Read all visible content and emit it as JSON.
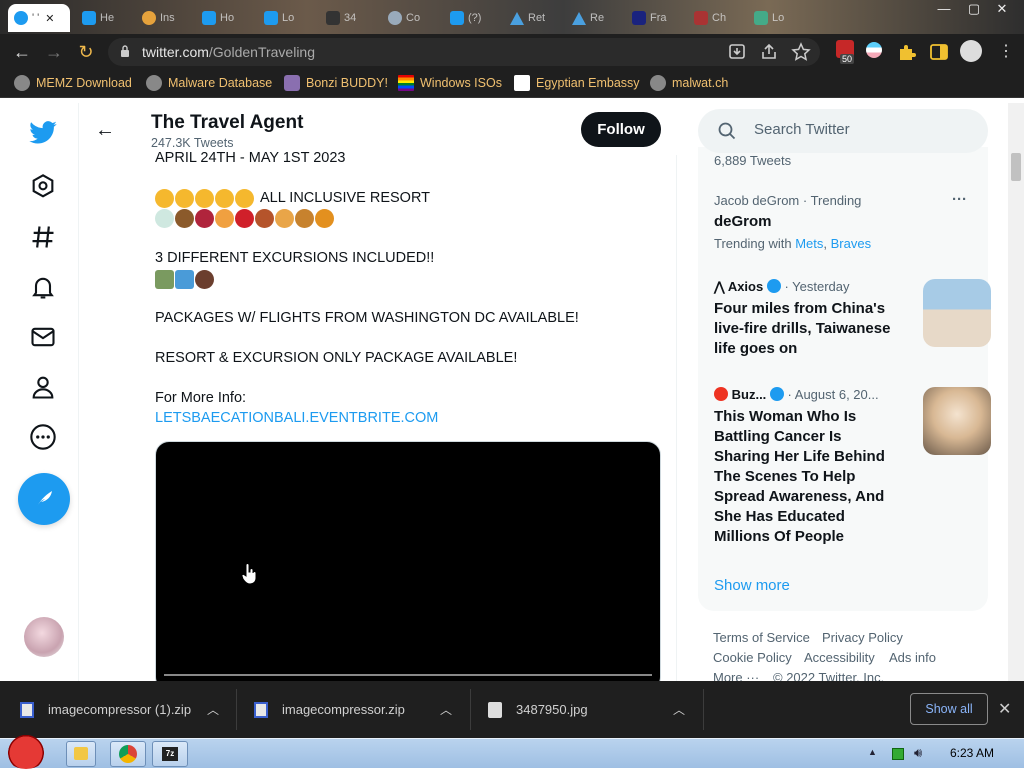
{
  "browser": {
    "tabs": [
      {
        "label": "' '",
        "active": true
      },
      {
        "label": "He"
      },
      {
        "label": "Ins"
      },
      {
        "label": "Ho"
      },
      {
        "label": "Lo"
      },
      {
        "label": "34"
      },
      {
        "label": "Co"
      },
      {
        "label": "(?)"
      },
      {
        "label": "Ret"
      },
      {
        "label": "Re"
      },
      {
        "label": "Fra"
      },
      {
        "label": "Ch"
      },
      {
        "label": "Lo"
      }
    ],
    "window_controls": {
      "minimize": "—",
      "maximize": "▢",
      "close": "✕"
    },
    "url_domain": "twitter.com",
    "url_path": "/GoldenTraveling",
    "extension_badge": "50",
    "bookmarks": [
      {
        "label": "MEMZ Download"
      },
      {
        "label": "Malware Database"
      },
      {
        "label": "Bonzi BUDDY!"
      },
      {
        "label": "Windows ISOs"
      },
      {
        "label": "Egyptian Embassy"
      },
      {
        "label": "malwat.ch"
      }
    ]
  },
  "profile": {
    "name": "The Travel Agent",
    "tweet_count": "247.3K Tweets",
    "follow_label": "Follow"
  },
  "tweet": {
    "line1": "APRIL 24TH - MAY 1ST 2023",
    "line2": "ALL INCLUSIVE RESORT",
    "line3": "3 DIFFERENT EXCURSIONS INCLUDED!!",
    "line4": "PACKAGES W/ FLIGHTS FROM WASHINGTON DC AVAILABLE!",
    "line5": "RESORT & EXCURSION ONLY PACKAGE AVAILABLE!",
    "line6": "For More Info:",
    "link": "LETSBAECATIONBALI.EVENTBRITE.COM"
  },
  "sidebar": {
    "search_placeholder": "Search Twitter",
    "prev_trend_count": "6,889 Tweets",
    "trend": {
      "context": "Jacob deGrom · Trending",
      "name": "deGrom",
      "trending_with": "Trending with",
      "related1": "Mets",
      "comma": ",",
      "related2": "Braves",
      "more": "···"
    },
    "news": [
      {
        "source": "Axios",
        "time": "· Yesterday",
        "headline": "Four miles from China's live-fire drills, Taiwanese life goes on"
      },
      {
        "source": "Buz...",
        "time": "· August 6, 20...",
        "headline": "This Woman Who Is Battling Cancer Is Sharing Her Life Behind The Scenes To Help Spread Awareness, And She Has Educated Millions Of People"
      }
    ],
    "show_more": "Show more",
    "footer": {
      "terms": "Terms of Service",
      "privacy": "Privacy Policy",
      "cookie": "Cookie Policy",
      "accessibility": "Accessibility",
      "ads": "Ads info",
      "more": "More ···",
      "copyright": "© 2022 Twitter, Inc."
    }
  },
  "downloads": {
    "items": [
      {
        "name": "imagecompressor (1).zip"
      },
      {
        "name": "imagecompressor.zip"
      },
      {
        "name": "3487950.jpg"
      }
    ],
    "show_all": "Show all",
    "close": "✕"
  },
  "taskbar": {
    "clock": "6:23 AM"
  },
  "colors": {
    "twitter_blue": "#1d9bf0",
    "text_primary": "#0f1419",
    "text_secondary": "#536471",
    "bookmark_text": "#f0c070"
  }
}
